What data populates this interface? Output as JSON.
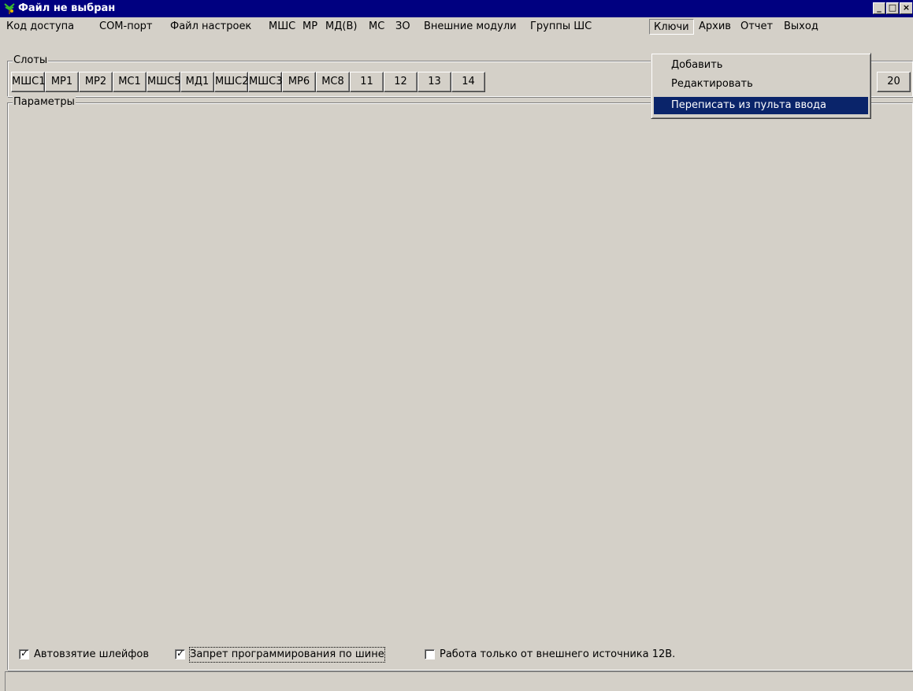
{
  "window": {
    "title": "Файл не выбран",
    "icon": "app-tree-icon",
    "controls": [
      "minimize-icon",
      "maximize-icon",
      "close-icon"
    ]
  },
  "menu": [
    "Код доступа",
    "СОМ-порт",
    "Файл настроек",
    "МШС",
    "МР",
    "МД(В)",
    "МС",
    "ЗО",
    "Внешние модули",
    "Группы ШС",
    "Ключи",
    "Архив",
    "Отчет",
    "Выход"
  ],
  "open_menu": "Ключи",
  "dropdown": {
    "items": [
      "Добавить",
      "Редактировать",
      "Переписать из пульта ввода"
    ],
    "highlighted": "Переписать из пульта ввода"
  },
  "slots": {
    "label": "Слоты",
    "buttons": [
      "МШС1",
      "МР1",
      "МР2",
      "МС1",
      "МШС5",
      "МД1",
      "МШС2",
      "МШС3",
      "МР6",
      "МС8",
      "11",
      "12",
      "13",
      "14",
      "20"
    ]
  },
  "params": {
    "label": "Параметры"
  },
  "options": [
    {
      "label": "Автовзятие шлейфов",
      "checked": true
    },
    {
      "label": "Запрет программирования по шине",
      "checked": true
    },
    {
      "label": "Работа только от внешнего источника 12В.",
      "checked": false
    }
  ],
  "colors": {
    "titlebar": "#000080",
    "face": "#d4d0c8",
    "highlight": "#0a246a"
  }
}
